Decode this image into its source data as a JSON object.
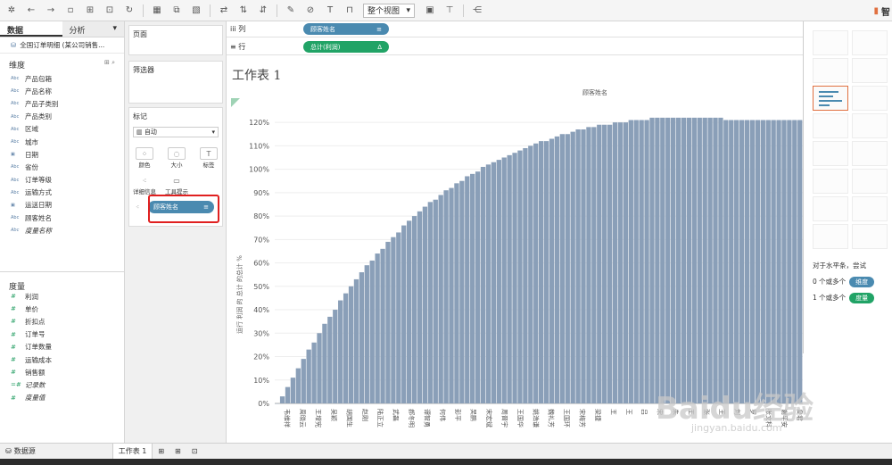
{
  "toolbar": {
    "view_select": "整个视图",
    "smart_label": "智"
  },
  "left": {
    "tabs": [
      "数据",
      "分析"
    ],
    "datasource": "全国订单明细 (某公司销售...",
    "dimensions_header": "维度",
    "dimensions": [
      {
        "type": "Abc",
        "label": "产品包箱"
      },
      {
        "type": "Abc",
        "label": "产品名称"
      },
      {
        "type": "Abc",
        "label": "产品子类别"
      },
      {
        "type": "Abc",
        "label": "产品类别"
      },
      {
        "type": "Abc",
        "label": "区域"
      },
      {
        "type": "Abc",
        "label": "城市"
      },
      {
        "type": "▣",
        "label": "日期"
      },
      {
        "type": "Abc",
        "label": "省份"
      },
      {
        "type": "Abc",
        "label": "订单等级"
      },
      {
        "type": "Abc",
        "label": "运输方式"
      },
      {
        "type": "▣",
        "label": "运送日期"
      },
      {
        "type": "Abc",
        "label": "顾客姓名"
      },
      {
        "type": "Abc",
        "label": "度量名称"
      }
    ],
    "measures_header": "度量",
    "measures": [
      {
        "type": "#",
        "label": "利润"
      },
      {
        "type": "#",
        "label": "单价"
      },
      {
        "type": "#",
        "label": "折扣点"
      },
      {
        "type": "#",
        "label": "订单号"
      },
      {
        "type": "#",
        "label": "订单数量"
      },
      {
        "type": "#",
        "label": "运输成本"
      },
      {
        "type": "#",
        "label": "销售额"
      },
      {
        "type": "=#",
        "label": "记录数"
      },
      {
        "type": "#",
        "label": "度量值"
      }
    ]
  },
  "mid": {
    "pages": "页面",
    "filters": "筛选器",
    "marks": "标记",
    "mark_type": "自动",
    "buttons": [
      "颜色",
      "大小",
      "标签",
      "详细信息",
      "工具提示"
    ],
    "mark_pill": "顾客姓名"
  },
  "shelves": {
    "columns_label": "列",
    "columns_pill": "顾客姓名",
    "rows_label": "行",
    "rows_pill": "总计(利润)"
  },
  "sheet_title": "工作表 1",
  "right_panel": {
    "hint": "对于水平条，尝试",
    "line1_prefix": "0 个或多个",
    "line1_tag": "维度",
    "line2_prefix": "1 个或多个",
    "line2_tag": "度量"
  },
  "bottom": {
    "datasource_tab": "数据源",
    "sheet_tab": "工作表 1"
  },
  "watermark": {
    "main": "Baidu经验",
    "sub": "jingyan.baidu.com"
  },
  "chart_data": {
    "type": "bar",
    "title": "顾客姓名",
    "ylabel": "运行 利润 的 总计 的总计 %",
    "yticks": [
      "0%",
      "10%",
      "20%",
      "30%",
      "40%",
      "50%",
      "60%",
      "70%",
      "80%",
      "90%",
      "100%",
      "110%",
      "120%"
    ],
    "ylim": [
      0,
      125
    ],
    "x_tick_labels": [
      "韦维祥",
      "周晓云",
      "王增宪",
      "吴颖",
      "胡国生",
      "赵刚",
      "陆正立",
      "武磊",
      "郝冬明",
      "谭智勇",
      "何伟",
      "彭平",
      "吴鹏",
      "宋宏斌",
      "周晋宇",
      "王国华",
      "姚浩谦",
      "魏礼芳",
      "王国环",
      "宋梅芳",
      "梁捷",
      "王",
      "王",
      "吕",
      "宋",
      "朱",
      "王",
      "张",
      "王",
      "刘",
      "罗",
      "张文科",
      "谢平安",
      "夏君"
    ],
    "series": [
      {
        "values": [
          0,
          3,
          7,
          11,
          15,
          19,
          23,
          26,
          30,
          34,
          37,
          40,
          44,
          47,
          50,
          53,
          56,
          59,
          61,
          64,
          66,
          69,
          71,
          73,
          76,
          78,
          80,
          82,
          84,
          86,
          87,
          89,
          91,
          92,
          94,
          95,
          97,
          98,
          99,
          101,
          102,
          103,
          104,
          105,
          106,
          107,
          108,
          109,
          110,
          111,
          112,
          112,
          113,
          114,
          115,
          115,
          116,
          117,
          117,
          118,
          118,
          119,
          119,
          119,
          120,
          120,
          120,
          121,
          121,
          121,
          121,
          122,
          122,
          122,
          122,
          122,
          122,
          122,
          122,
          122,
          122,
          122,
          122,
          122,
          122,
          121,
          121,
          121,
          121,
          121,
          121,
          121,
          121,
          121,
          121,
          121,
          121,
          121,
          121,
          121
        ]
      }
    ],
    "bar_color": "#8a9fb8",
    "grid": true
  }
}
